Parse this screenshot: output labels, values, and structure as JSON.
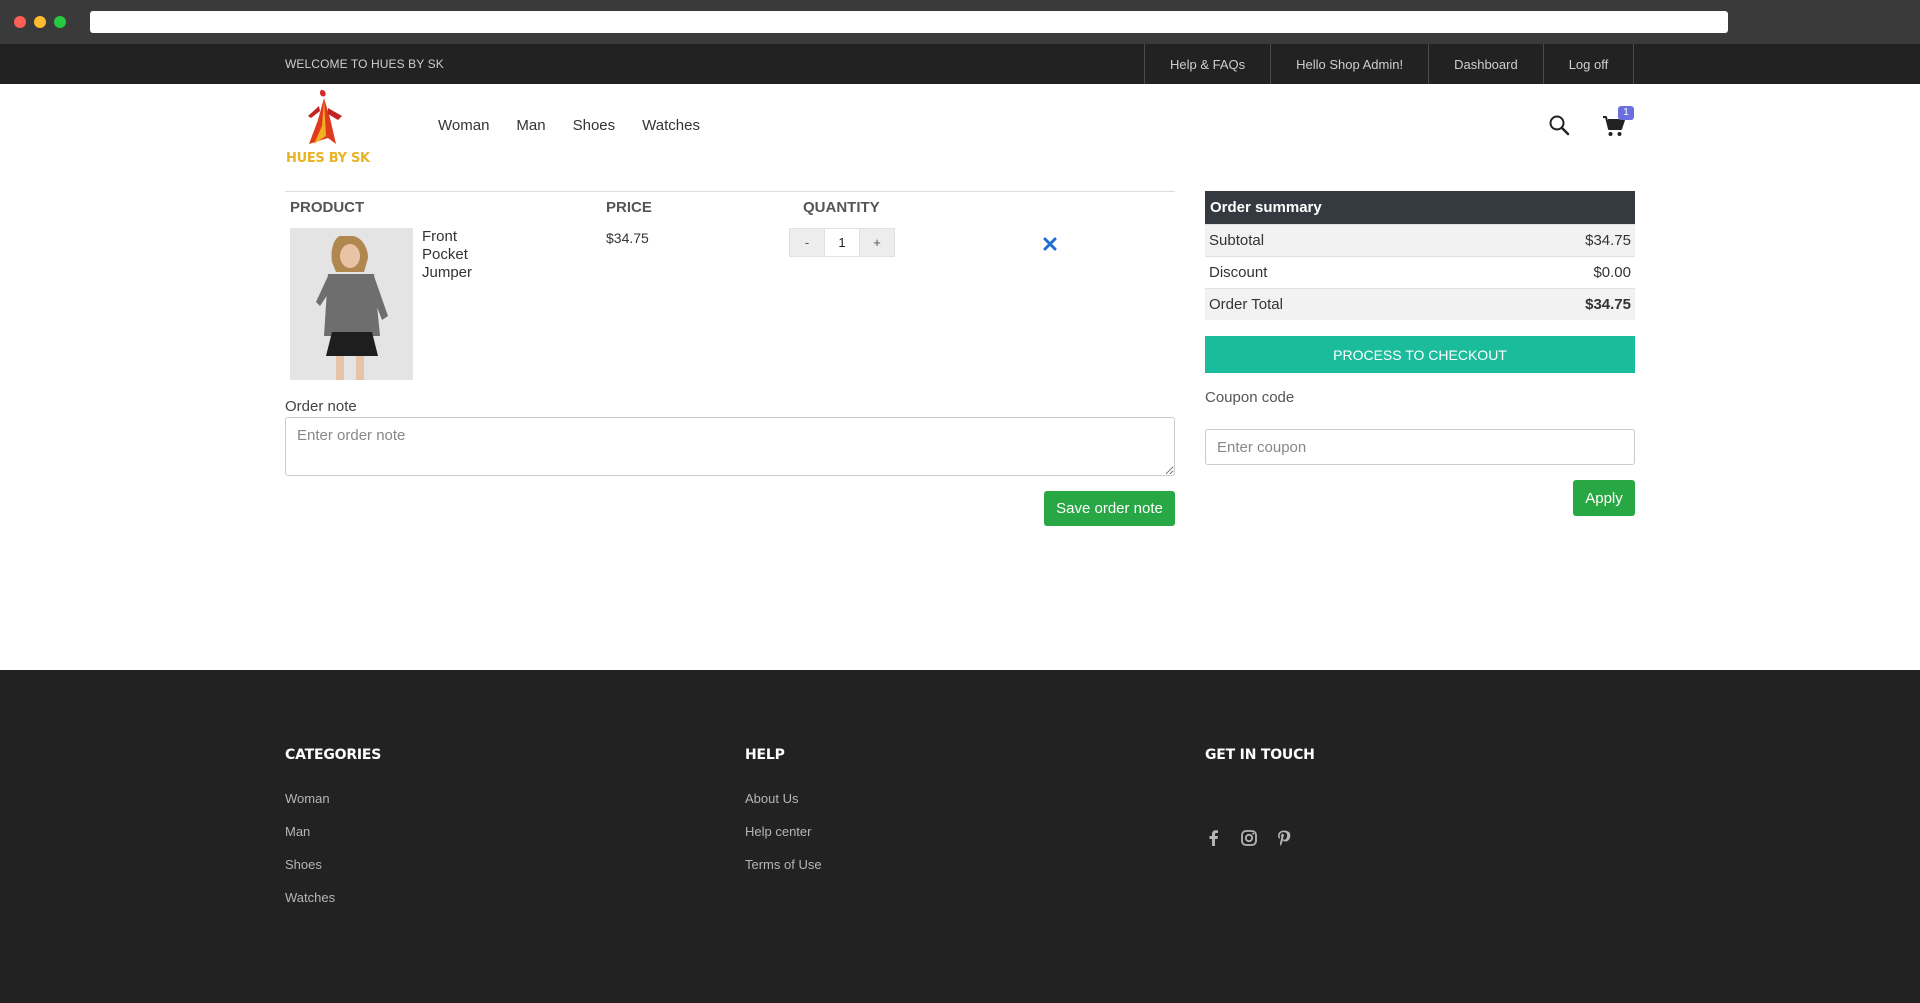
{
  "topbar": {
    "welcome": "WELCOME TO HUES BY SK",
    "links": [
      "Help & FAQs",
      "Hello Shop Admin!",
      "Dashboard",
      "Log off"
    ]
  },
  "brand": {
    "logo_text": "HUES BY SK"
  },
  "nav": {
    "items": [
      "Woman",
      "Man",
      "Shoes",
      "Watches"
    ]
  },
  "header_icons": {
    "search": "search-icon",
    "cart": "cart-icon",
    "cart_count": "1"
  },
  "cart": {
    "headers": {
      "product": "PRODUCT",
      "price": "PRICE",
      "quantity": "QUANTITY"
    },
    "items": [
      {
        "name": "Front Pocket Jumper",
        "price": "$34.75",
        "quantity": "1",
        "minus": "-",
        "plus": "+"
      }
    ]
  },
  "order_note": {
    "label": "Order note",
    "placeholder": "Enter order note",
    "button": "Save order note"
  },
  "summary": {
    "title": "Order summary",
    "subtotal_label": "Subtotal",
    "subtotal": "$34.75",
    "discount_label": "Discount",
    "discount": "$0.00",
    "total_label": "Order Total",
    "total": "$34.75",
    "checkout": "PROCESS TO CHECKOUT",
    "coupon_label": "Coupon code",
    "coupon_placeholder": "Enter coupon",
    "apply": "Apply"
  },
  "footer": {
    "categories": {
      "title": "CATEGORIES",
      "links": [
        "Woman",
        "Man",
        "Shoes",
        "Watches"
      ]
    },
    "help": {
      "title": "HELP",
      "links": [
        "About Us",
        "Help center",
        "Terms of Use"
      ]
    },
    "contact": {
      "title": "GET IN TOUCH",
      "socials": [
        "facebook-icon",
        "instagram-icon",
        "pinterest-icon"
      ]
    }
  },
  "colors": {
    "accent_teal": "#1abc9c",
    "green": "#28a745",
    "dark": "#222222",
    "badge": "#6b6fe0"
  }
}
